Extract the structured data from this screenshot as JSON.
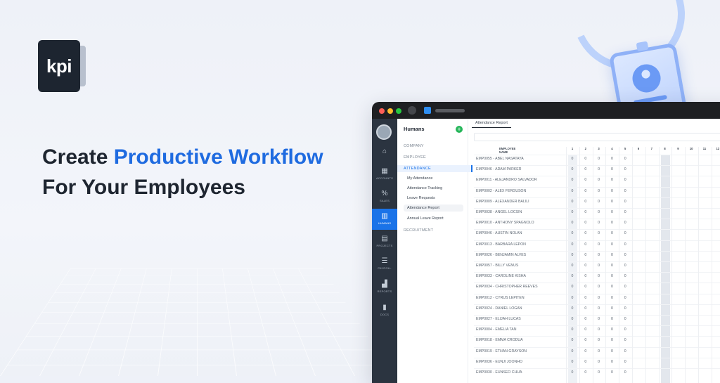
{
  "brand": {
    "logo_text": "kpi"
  },
  "headline": {
    "line1_prefix": "Create",
    "line1_accent": "Productive Workflow",
    "line2": "For Your Employees"
  },
  "colors": {
    "accent": "#1f6be0",
    "rail": "#2b3440",
    "rail_active": "#1a73e8",
    "add_button": "#26b65a"
  },
  "app": {
    "rail_items": [
      {
        "icon": "home-icon",
        "glyph": "⌂",
        "label": ""
      },
      {
        "icon": "accounts-icon",
        "glyph": "▦",
        "label": "ACCOUNTS"
      },
      {
        "icon": "sales-icon",
        "glyph": "%",
        "label": "SALES"
      },
      {
        "icon": "humans-icon",
        "glyph": "▥",
        "label": "HUMANS"
      },
      {
        "icon": "projects-icon",
        "glyph": "▤",
        "label": "PROJECTS"
      },
      {
        "icon": "payroll-icon",
        "glyph": "☰",
        "label": "PAYROLL"
      },
      {
        "icon": "reports-icon",
        "glyph": "▟",
        "label": "REPORTS"
      },
      {
        "icon": "docs-icon",
        "glyph": "▮",
        "label": "DOCS"
      }
    ],
    "subnav": {
      "title": "Humans",
      "add": "+",
      "sections": [
        "COMPANY",
        "EMPLOYEE",
        "ATTENDANCE"
      ],
      "sub_items": [
        "My Attendance",
        "Attendance Tracking",
        "Leave Requests",
        "Attendance Report",
        "Annual Leave Report"
      ],
      "after": "RECRUITMENT"
    },
    "tab": "Attendance Report",
    "table": {
      "name_header": "EMPLOYEE NAME",
      "day_headers": [
        "1",
        "2",
        "3",
        "4",
        "5",
        "6",
        "7",
        "8",
        "9",
        "10",
        "11",
        "12"
      ],
      "rows": [
        "EMP0055 - ABEL NASATAYA",
        "EMP0046 - ADAM PARKER",
        "EMP0011 - ALEJANDRO SALVADOR",
        "EMP0002 - ALEX FERGUSON",
        "EMP0009 - ALEXANDER BALILI",
        "EMP0038 - ANGEL LOCSIN",
        "EMP0010 - ANTHONY SPAGNOLO",
        "EMP0046 - AUSTIN NOLAN",
        "EMP0013 - BARBARA LEPON",
        "EMP0026 - BENJAMIN ALVES",
        "EMP0057 - BILLY VENUS",
        "EMP0033 - CAROLINE KISHA",
        "EMP0034 - CHRISTOPHER REEVES",
        "EMP0012 - CYRUS LEPITEN",
        "EMP0024 - DANIEL LOGAN",
        "EMP0027 - ELIJAH LUCAS",
        "EMP0004 - EMELIA TAN",
        "EMP0018 - EMMA CRODUA",
        "EMP0019 - ETHAN GRAYSON",
        "EMP0036 - EUNJI JOONHO",
        "EMP0030 - EUNSEO CHUA"
      ],
      "cell_value": "0"
    }
  }
}
